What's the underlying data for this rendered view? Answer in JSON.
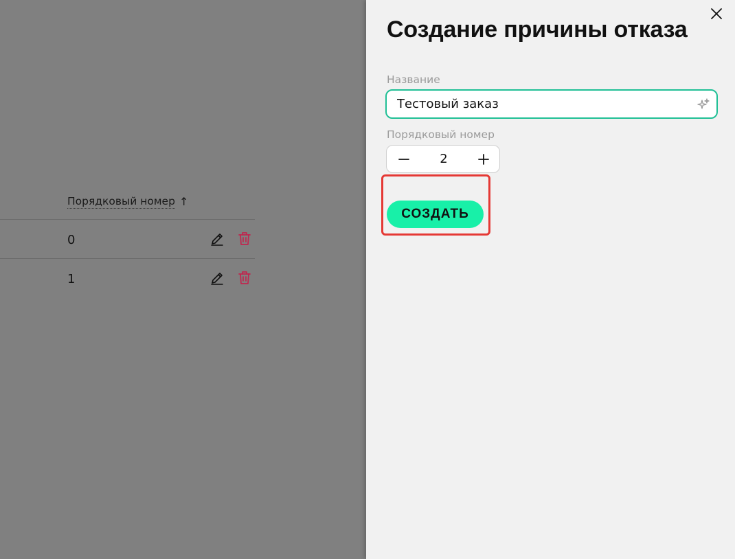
{
  "table": {
    "column_header": "Порядковый номер",
    "sort_arrow": "↑",
    "rows": [
      {
        "order": "0"
      },
      {
        "order": "1"
      }
    ],
    "icons": {
      "edit": "pencil-icon",
      "delete": "trash-icon"
    },
    "colors": {
      "delete": "#c0264e"
    }
  },
  "drawer": {
    "title": "Создание причины отказа",
    "close_icon": "close-icon",
    "name_label": "Название",
    "name_value": "Тестовый заказ",
    "name_icon": "sparkle-icon",
    "order_label": "Порядковый номер",
    "order_value": "2",
    "submit_label": "СОЗДАТЬ",
    "colors": {
      "accent": "#18f0a8",
      "input_border": "#1fbf95",
      "highlight": "#e53935"
    }
  }
}
